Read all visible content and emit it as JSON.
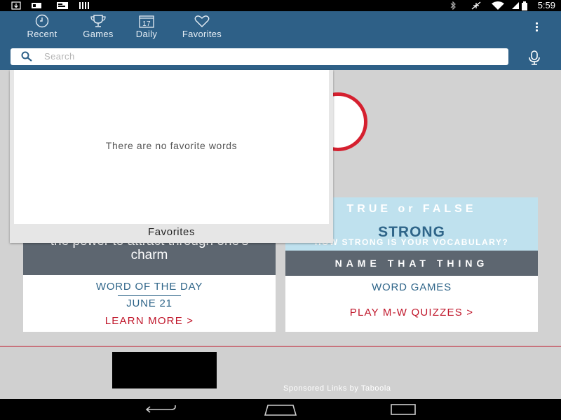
{
  "status_bar": {
    "time": "5:59"
  },
  "app_bar": {
    "tabs": [
      {
        "label": "Recent",
        "icon": "clock-icon"
      },
      {
        "label": "Games",
        "icon": "trophy-icon"
      },
      {
        "label": "Daily",
        "icon": "calendar-icon",
        "icon_text": "17"
      },
      {
        "label": "Favorites",
        "icon": "heart-icon"
      }
    ],
    "search": {
      "placeholder": "Search"
    }
  },
  "word_of_the_day": {
    "definition": "the power to attract through one's charm",
    "heading": "WORD OF THE DAY",
    "date": "JUNE 21",
    "link": "LEARN MORE >"
  },
  "word_games": {
    "banner_line1": "TRUE or FALSE",
    "banner_strong": "STRONG",
    "banner_line2": "HOW STRONG IS YOUR VOCABULARY?",
    "banner_game": "NAME THAT THING",
    "heading": "WORD GAMES",
    "link": "PLAY M-W QUIZZES >"
  },
  "ads": {
    "sponsored": "Sponsored Links by Taboola"
  },
  "favorites_popup": {
    "empty_message": "There are no favorite words",
    "title": "Favorites"
  },
  "colors": {
    "app_bar": "#2e6087",
    "accent_red": "#c0162a",
    "title_blue": "#2f6589"
  }
}
